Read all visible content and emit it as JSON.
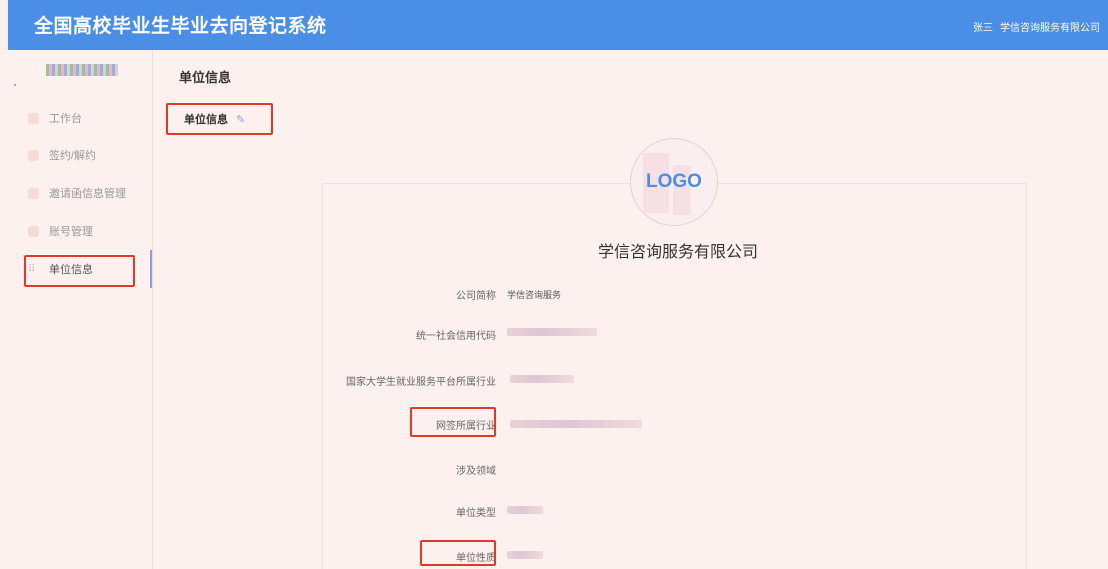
{
  "header": {
    "system_title": "全国高校毕业生毕业去向登记系统",
    "user_name": "张三",
    "org_name": "学信咨询服务有限公司"
  },
  "sidebar": {
    "items": [
      {
        "label": "工作台",
        "icon": "dashboard-icon"
      },
      {
        "label": "签约/解约",
        "icon": "document-icon"
      },
      {
        "label": "邀请函信息管理",
        "icon": "mail-icon"
      },
      {
        "label": "账号管理",
        "icon": "user-icon"
      },
      {
        "label": "单位信息",
        "icon": "grid-icon",
        "active": true
      }
    ]
  },
  "main": {
    "page_title": "单位信息",
    "tab_label": "单位信息",
    "tab_edit_icon": "✎",
    "logo_text": "LOGO",
    "company_name": "学信咨询服务有限公司",
    "fields": [
      {
        "label": "公司简称",
        "value": "学信咨询服务"
      },
      {
        "label": "统一社会信用代码",
        "value": ""
      },
      {
        "label": "国家大学生就业服务平台所属行业",
        "value": ""
      },
      {
        "label": "网签所属行业",
        "value": ""
      },
      {
        "label": "涉及领域",
        "value": ""
      },
      {
        "label": "单位类型",
        "value": ""
      },
      {
        "label": "单位性质",
        "value": ""
      }
    ]
  },
  "colors": {
    "header_bg": "#4a8ee6",
    "highlight": "#e03a2a",
    "page_bg": "#fdf1ef"
  }
}
